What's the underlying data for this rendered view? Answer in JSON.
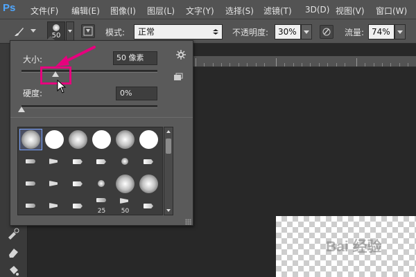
{
  "app": {
    "logo": "Ps"
  },
  "menu": [
    {
      "label": "文件(F)"
    },
    {
      "label": "编辑(E)"
    },
    {
      "label": "图像(I)"
    },
    {
      "label": "图层(L)"
    },
    {
      "label": "文字(Y)"
    },
    {
      "label": "选择(S)"
    },
    {
      "label": "滤镜(T)"
    },
    {
      "label": "3D(D)"
    },
    {
      "label": "视图(V)"
    },
    {
      "label": "窗口(W)"
    }
  ],
  "options": {
    "brush_size": "50",
    "mode_label": "模式:",
    "mode_value": "正常",
    "opacity_label": "不透明度:",
    "opacity_value": "30%",
    "flow_label": "流量:",
    "flow_value": "74%"
  },
  "brush_panel": {
    "size_label": "大小:",
    "size_value": "50 像素",
    "size_slider_fraction": 0.25,
    "hardness_label": "硬度:",
    "hardness_value": "0%",
    "hardness_slider_fraction": 0.0,
    "presets": [
      {
        "kind": "soft",
        "selected": true
      },
      {
        "kind": "hard"
      },
      {
        "kind": "soft"
      },
      {
        "kind": "hard"
      },
      {
        "kind": "soft"
      },
      {
        "kind": "hard"
      },
      {
        "kind": "tip-a"
      },
      {
        "kind": "tip-b"
      },
      {
        "kind": "tip-c"
      },
      {
        "kind": "tip-c"
      },
      {
        "kind": "tip-d"
      },
      {
        "kind": "tip-c"
      },
      {
        "kind": "tip-a"
      },
      {
        "kind": "tip-b"
      },
      {
        "kind": "tip-c"
      },
      {
        "kind": "tip-d"
      },
      {
        "kind": "soft"
      },
      {
        "kind": "soft"
      },
      {
        "kind": "tip-a"
      },
      {
        "kind": "tip-b"
      },
      {
        "kind": "tip-c"
      },
      {
        "kind": "tip-a",
        "label": "25"
      },
      {
        "kind": "tip-b",
        "label": "50"
      },
      {
        "kind": "tip-c"
      }
    ]
  },
  "watermark": "Bai 经验",
  "colors": {
    "accent_highlight": "#e6007e",
    "selection": "#7aa4ff",
    "ps_blue": "#4fa7ff"
  }
}
